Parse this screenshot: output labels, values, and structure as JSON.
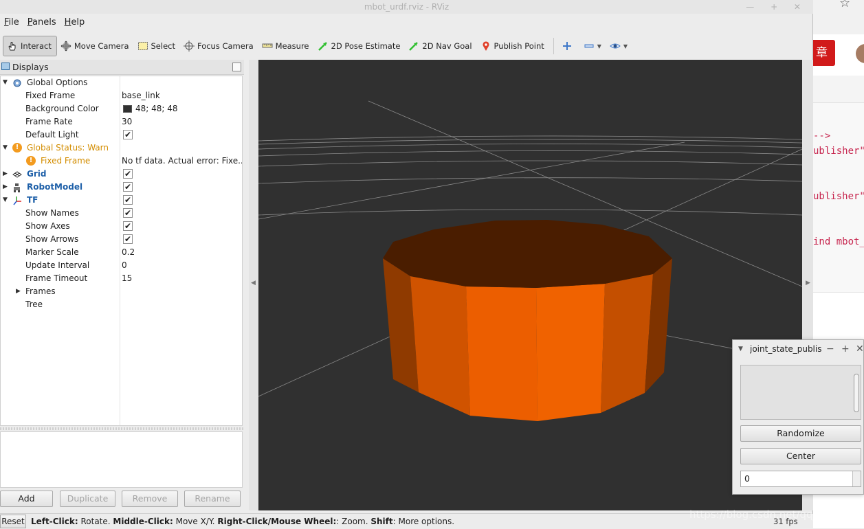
{
  "window": {
    "title": "mbot_urdf.rviz - RViz",
    "controls": "— + ✕"
  },
  "menu": {
    "file_pre": "",
    "file_u": "F",
    "file_post": "ile",
    "panels_pre": "",
    "panels_u": "P",
    "panels_post": "anels",
    "help_pre": "",
    "help_u": "H",
    "help_post": "elp"
  },
  "toolbar": {
    "interact": "Interact",
    "move_camera": "Move Camera",
    "select": "Select",
    "focus_camera": "Focus Camera",
    "measure": "Measure",
    "pose_estimate": "2D Pose Estimate",
    "nav_goal": "2D Nav Goal",
    "publish_point": "Publish Point"
  },
  "displays": {
    "title": "Displays",
    "rows": [
      {
        "label": "Global Options",
        "value": ""
      },
      {
        "label": "Fixed Frame",
        "value": "base_link"
      },
      {
        "label": "Background Color",
        "value": "48; 48; 48"
      },
      {
        "label": "Frame Rate",
        "value": "30"
      },
      {
        "label": "Default Light",
        "value": ""
      },
      {
        "label": "Global Status: Warn",
        "value": ""
      },
      {
        "label": "Fixed Frame",
        "value": "No tf data.  Actual error: Fixe..."
      },
      {
        "label": "Grid",
        "value": ""
      },
      {
        "label": "RobotModel",
        "value": ""
      },
      {
        "label": "TF",
        "value": ""
      },
      {
        "label": "Show Names",
        "value": ""
      },
      {
        "label": "Show Axes",
        "value": ""
      },
      {
        "label": "Show Arrows",
        "value": ""
      },
      {
        "label": "Marker Scale",
        "value": "0.2"
      },
      {
        "label": "Update Interval",
        "value": "0"
      },
      {
        "label": "Frame Timeout",
        "value": "15"
      },
      {
        "label": "Frames",
        "value": ""
      },
      {
        "label": "Tree",
        "value": ""
      }
    ],
    "buttons": {
      "add": "Add",
      "duplicate": "Duplicate",
      "remove": "Remove",
      "rename": "Rename"
    }
  },
  "viewport": {
    "background_color": "#303030",
    "model_color": "#e85c00"
  },
  "status": {
    "reset": "Reset",
    "h1": "Left-Click:",
    "t1": " Rotate. ",
    "h2": "Middle-Click:",
    "t2": " Move X/Y. ",
    "h3": "Right-Click/Mouse Wheel:",
    "t3": ": Zoom. ",
    "h4": "Shift",
    "t4": ": More options.",
    "fps": "31 fps"
  },
  "watermark": "https://blog.csdn.net/qq_38441692",
  "joint_state": {
    "title": "joint_state_publis",
    "randomize": "Randomize",
    "center": "Center",
    "value": "0"
  },
  "background_page": {
    "button_char": "章",
    "code_lines": [
      "-->",
      "ublisher\"",
      "ublisher\"",
      "ind mbot_"
    ]
  }
}
